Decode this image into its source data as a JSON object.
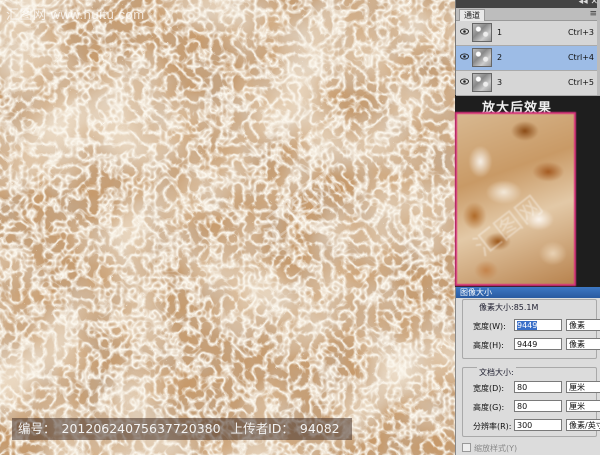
{
  "watermark": {
    "top_left": "汇图网 www.huitu.com",
    "center": "汇图网"
  },
  "caption": {
    "id_label": "编号：",
    "id_value": "20120624075637720380",
    "uploader_label": "上传者ID：",
    "uploader_value": "94082"
  },
  "channels": {
    "tab": "通道",
    "rows": [
      {
        "name": "1",
        "shortcut": "Ctrl+3",
        "selected": false
      },
      {
        "name": "2",
        "shortcut": "Ctrl+4",
        "selected": true
      },
      {
        "name": "3",
        "shortcut": "Ctrl+5",
        "selected": false
      }
    ]
  },
  "zoom_preview": {
    "title": "放大后效果",
    "border_color": "#d8307a"
  },
  "image_size": {
    "title": "图像大小",
    "pixel_dims_label": "像素大小:85.1M",
    "width_label": "宽度(W):",
    "width_value": "9449",
    "width_unit": "像素",
    "height_label": "高度(H):",
    "height_value": "9449",
    "height_unit": "像素",
    "doc_size_label": "文档大小:",
    "doc_width_label": "宽度(D):",
    "doc_width_value": "80",
    "doc_width_unit": "厘米",
    "doc_height_label": "高度(G):",
    "doc_height_value": "80",
    "doc_height_unit": "厘米",
    "resolution_label": "分辨率(R):",
    "resolution_value": "300",
    "resolution_unit": "像素/英寸",
    "scale_styles_label": "缩放样式(Y)"
  }
}
